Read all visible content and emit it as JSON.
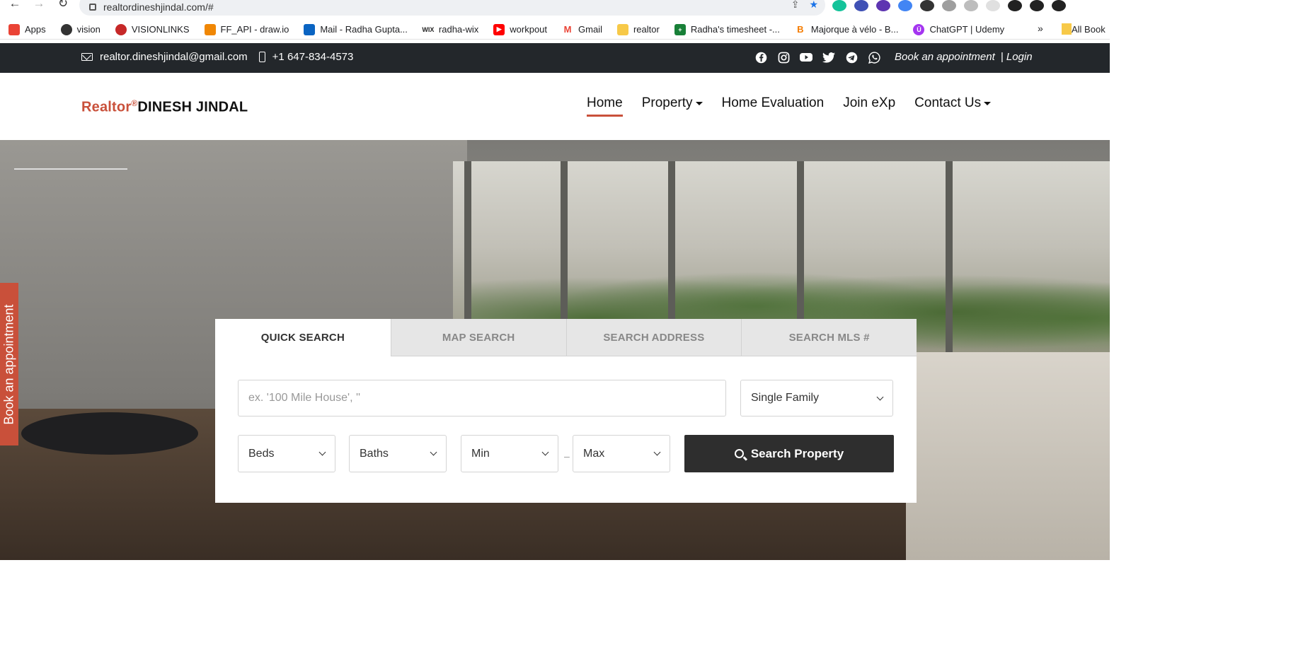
{
  "browser": {
    "url": "realtordineshjindal.com/#",
    "bookmarks": [
      {
        "label": "Apps",
        "color": "#ea4335"
      },
      {
        "label": "vision",
        "color": "#333333"
      },
      {
        "label": "VISIONLINKS",
        "color": "#c62828"
      },
      {
        "label": "FF_API - draw.io",
        "color": "#f08705"
      },
      {
        "label": "Mail - Radha Gupta...",
        "color": "#0a64c2"
      },
      {
        "label": "radha-wix",
        "color": "#222222"
      },
      {
        "label": "workpout",
        "color": "#ff0000"
      },
      {
        "label": "Gmail",
        "color": "#ea4335"
      },
      {
        "label": "realtor",
        "color": "#f7c948"
      },
      {
        "label": "Radha's timesheet -...",
        "color": "#188038"
      },
      {
        "label": "Majorque à vélo - B...",
        "color": "#f57c00"
      },
      {
        "label": "ChatGPT | Udemy",
        "color": "#a435f0"
      }
    ],
    "bookmarks_more": "»",
    "all_bookmarks": "All Book"
  },
  "topbar": {
    "email": "realtor.dineshjindal@gmail.com",
    "phone": "+1 647-834-4573",
    "book": "Book an appointment",
    "login": "| Login"
  },
  "header": {
    "logo_realtor": "Realtor",
    "logo_reg": "®",
    "logo_name": "DINESH JINDAL",
    "nav": [
      "Home",
      "Property",
      "Home Evaluation",
      "Join eXp",
      "Contact Us"
    ]
  },
  "sidetab": "Book an appointment",
  "search": {
    "tabs": [
      "QUICK SEARCH",
      "MAP SEARCH",
      "SEARCH ADDRESS",
      "SEARCH MLS #"
    ],
    "location_placeholder": "ex. '100 Mile House', ''",
    "property_type": "Single Family",
    "beds": "Beds",
    "baths": "Baths",
    "min": "Min",
    "dash": "–",
    "max": "Max",
    "button": "Search Property"
  },
  "colors": {
    "accent": "#c9503a",
    "topbar": "#23272b",
    "button": "#2e2e2e"
  }
}
